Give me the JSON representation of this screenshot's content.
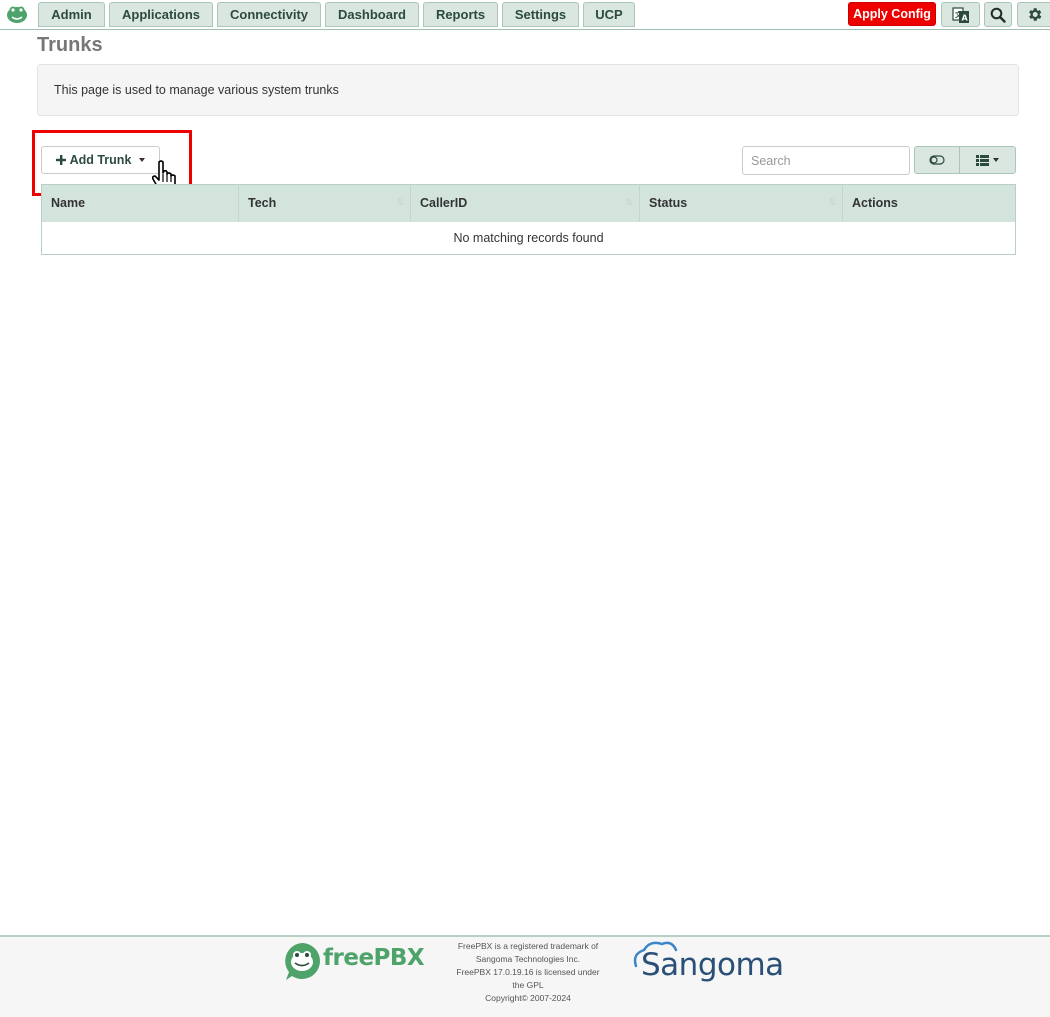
{
  "nav": {
    "tabs": [
      "Admin",
      "Applications",
      "Connectivity",
      "Dashboard",
      "Reports",
      "Settings",
      "UCP"
    ],
    "apply_label": "Apply Config"
  },
  "page": {
    "title": "Trunks",
    "info": "This page is used to manage various system trunks"
  },
  "toolbar": {
    "add_label": "Add Trunk",
    "search_placeholder": "Search"
  },
  "table": {
    "columns": [
      "Name",
      "Tech",
      "CallerID",
      "Status",
      "Actions"
    ],
    "empty_message": "No matching records found"
  },
  "footer": {
    "logo_text": "freePBX",
    "legal_line1": "FreePBX is a registered trademark of",
    "legal_line2": "Sangoma Technologies Inc.",
    "legal_line3": "FreePBX 17.0.19.16 is licensed under",
    "legal_line4": "the GPL",
    "legal_line5": "Copyright© 2007-2024",
    "brand": "Sangoma"
  },
  "colors": {
    "accent": "#d9e7e0",
    "apply": "#ee0000",
    "highlight": "#ee0000"
  }
}
